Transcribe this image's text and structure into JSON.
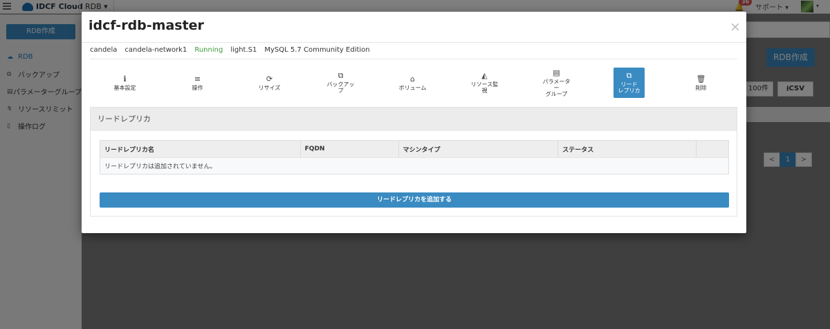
{
  "topbar": {
    "brand": "IDCF Cloud",
    "service": "RDB",
    "notification_count": "36",
    "support": "サポート"
  },
  "sidebar": {
    "create_button": "RDB作成",
    "items": [
      {
        "label": "RDB",
        "icon": "cloud-icon"
      },
      {
        "label": "バックアップ",
        "icon": "copy-icon"
      },
      {
        "label": "パラメーターグループ",
        "icon": "table-icon"
      },
      {
        "label": "リソースリミット",
        "icon": "bolt-icon"
      },
      {
        "label": "操作ログ",
        "icon": "document-icon"
      }
    ]
  },
  "background": {
    "create_button": "RDB作成",
    "count_select": "100件",
    "csv_button": "CSV",
    "pager": {
      "prev": "<",
      "current": "1",
      "next": ">"
    }
  },
  "modal": {
    "title": "idcf-rdb-master",
    "info": {
      "tenant": "candela",
      "network": "candela-network1",
      "status": "Running",
      "plan": "light.S1",
      "engine": "MySQL 5.7 Community Edition"
    },
    "tabs": [
      {
        "label": "基本設定",
        "icon": "info-icon",
        "glyph": "ℹ"
      },
      {
        "label": "操作",
        "icon": "database-icon",
        "glyph": "≡"
      },
      {
        "label": "リサイズ",
        "icon": "refresh-icon",
        "glyph": "⟳"
      },
      {
        "label": "バックアッ\nプ",
        "icon": "copy-icon",
        "glyph": "⧉"
      },
      {
        "label": "ボリューム",
        "icon": "hdd-icon",
        "glyph": "⌂"
      },
      {
        "label": "リソース監\n視",
        "icon": "area-chart-icon",
        "glyph": "◭"
      },
      {
        "label": "パラメータ\nー\nグループ",
        "icon": "list-alt-icon",
        "glyph": "▤"
      },
      {
        "label": "リード\nレプリカ",
        "icon": "clone-icon",
        "glyph": "⧉",
        "active": true
      },
      {
        "label": "削除",
        "icon": "trash-icon",
        "glyph": "🗑"
      }
    ],
    "section": {
      "title": "リードレプリカ",
      "columns": [
        "リードレプリカ名",
        "FQDN",
        "マシンタイプ",
        "ステータス",
        ""
      ],
      "empty_message": "リードレプリカは追加されていません。",
      "add_button": "リードレプリカを追加する"
    },
    "close_symbol": "×"
  }
}
